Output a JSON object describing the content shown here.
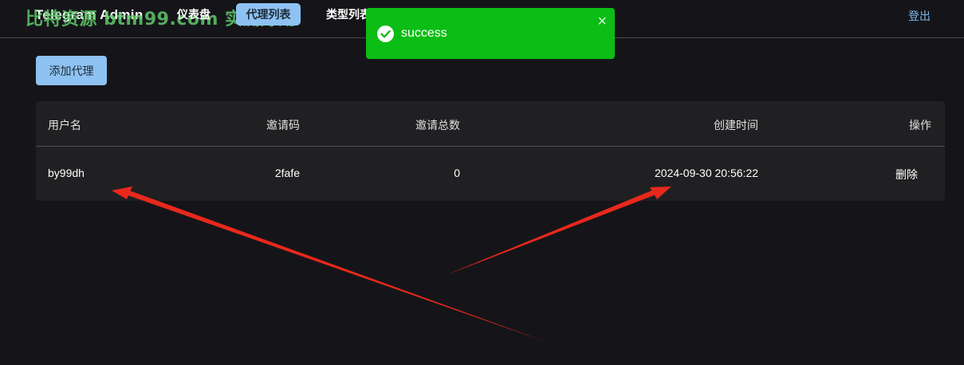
{
  "header": {
    "brand": "Telegram Admin",
    "watermark": "比特资源 btm99.com 实测好用",
    "nav": [
      {
        "label": "仪表盘"
      },
      {
        "label": "代理列表"
      },
      {
        "label": "类型列表"
      }
    ],
    "logout_label": "登出"
  },
  "toolbar": {
    "add_label": "添加代理"
  },
  "table": {
    "columns": [
      "用户名",
      "邀请码",
      "邀请总数",
      "创建时间",
      "操作"
    ],
    "rows": [
      {
        "username": "by99dh",
        "invite_code": "2fafe",
        "invite_total": "0",
        "created_at": "2024-09-30 20:56:22",
        "action": "删除"
      }
    ]
  },
  "toast": {
    "message": "success",
    "close_glyph": "×",
    "icon": "check-circle-icon",
    "color": "#0bbd14"
  },
  "colors": {
    "background": "#151519",
    "accent": "#8ec2f2",
    "danger": "#e05a4b",
    "annotation": "#e8281c"
  }
}
